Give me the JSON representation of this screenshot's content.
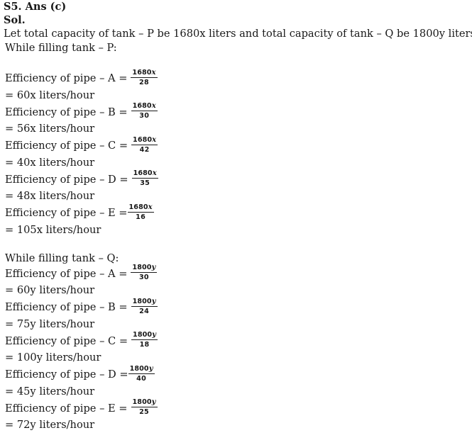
{
  "document": {
    "answer_heading": "S5. Ans (c)",
    "solution_heading": "Sol.",
    "premise": "Let total capacity of tank – P be 1680x liters and total capacity of tank – Q be 1800y liters.",
    "section_p_heading": "While filling tank – P:",
    "section_q_heading": "While filling tank – Q:"
  },
  "tank_p": {
    "rows": [
      {
        "lead": "Efficiency of pipe – A =",
        "numerator": "1680",
        "variable": "x",
        "denominator": "28",
        "result": "= 60x liters/hour",
        "spacing": "spaced"
      },
      {
        "lead": "Efficiency of pipe – B =",
        "numerator": "1680",
        "variable": "x",
        "denominator": "30",
        "result": "= 56x liters/hour",
        "spacing": "spaced"
      },
      {
        "lead": "Efficiency of pipe – C =",
        "numerator": "1680",
        "variable": "x",
        "denominator": "42",
        "result": "= 40x liters/hour",
        "spacing": "spaced"
      },
      {
        "lead": "Efficiency of pipe – D =",
        "numerator": "1680",
        "variable": "x",
        "denominator": "35",
        "result": "= 48x liters/hour",
        "spacing": "spaced"
      },
      {
        "lead": "Efficiency of pipe – E =",
        "numerator": "1680",
        "variable": "x",
        "denominator": "16",
        "result": "= 105x liters/hour",
        "spacing": "tight"
      }
    ]
  },
  "tank_q": {
    "rows": [
      {
        "lead": "Efficiency of pipe – A =",
        "numerator": "1800",
        "variable": "y",
        "denominator": "30",
        "result": "= 60y liters/hour",
        "spacing": "spaced"
      },
      {
        "lead": "Efficiency of pipe – B =",
        "numerator": "1800",
        "variable": "y",
        "denominator": "24",
        "result": "= 75y liters/hour",
        "spacing": "spaced"
      },
      {
        "lead": "Efficiency of pipe – C =",
        "numerator": "1800",
        "variable": "y",
        "denominator": "18",
        "result": "= 100y liters/hour",
        "spacing": "spaced"
      },
      {
        "lead": "Efficiency of pipe – D =",
        "numerator": "1800",
        "variable": "y",
        "denominator": "40",
        "result": "= 45y liters/hour",
        "spacing": "tight"
      },
      {
        "lead": "Efficiency of pipe – E =",
        "numerator": "1800",
        "variable": "y",
        "denominator": "25",
        "result": "= 72y liters/hour",
        "spacing": "spaced"
      }
    ]
  }
}
